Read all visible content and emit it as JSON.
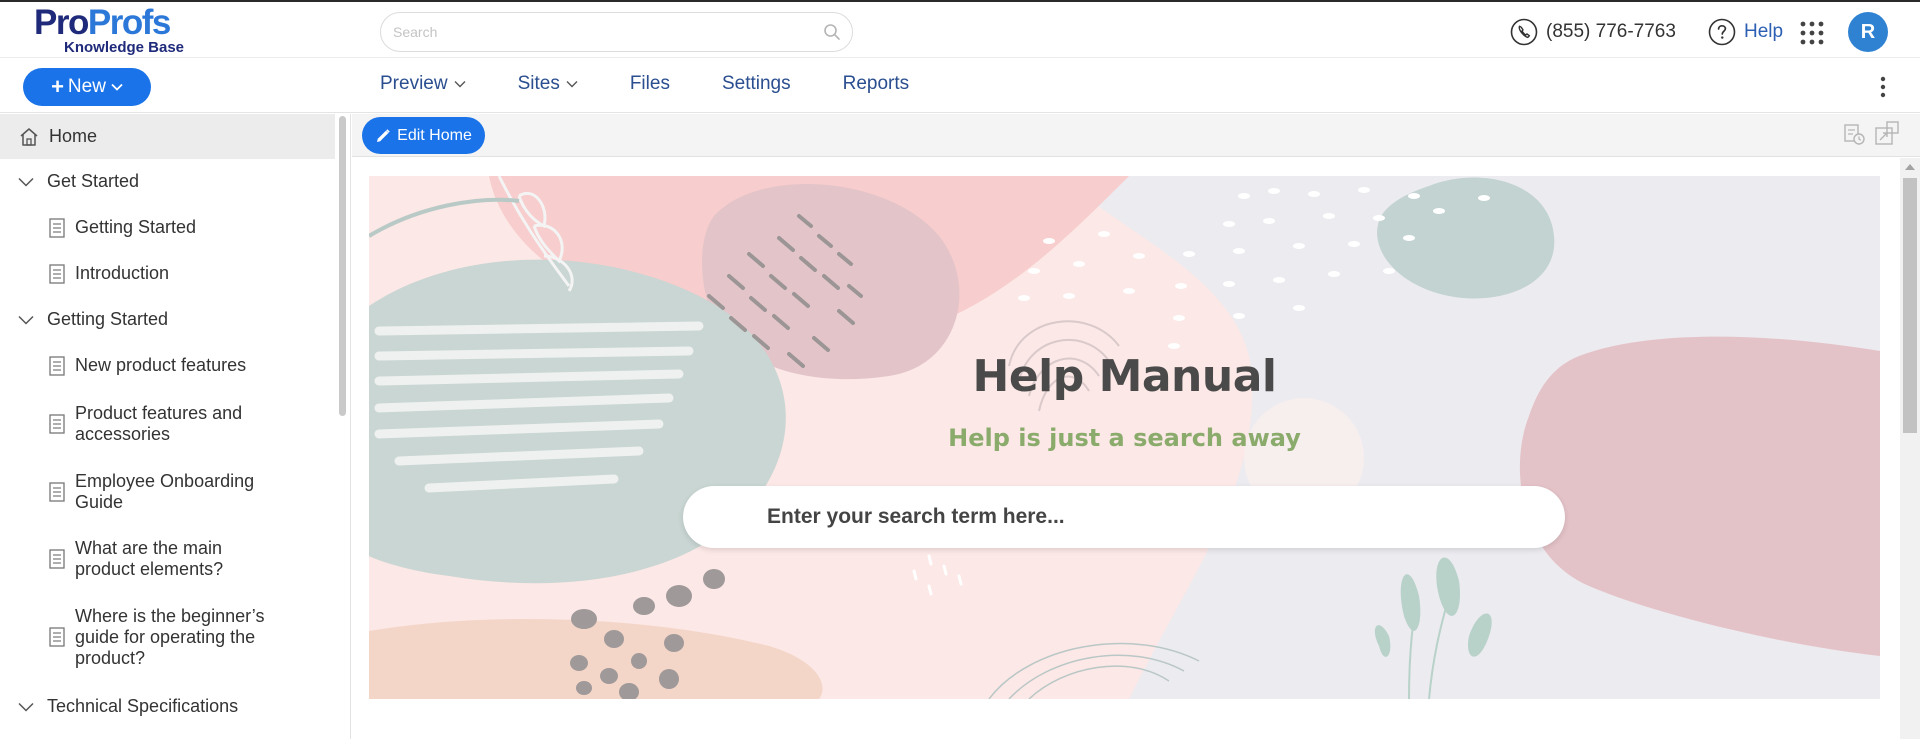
{
  "header": {
    "logo": {
      "brand_part1": "Pro",
      "brand_part2": "Profs",
      "product": "Knowledge Base"
    },
    "search_placeholder": "Search",
    "phone": "(855) 776-7763",
    "help_label": "Help",
    "avatar_initial": "R"
  },
  "toolbar": {
    "new_label": "New",
    "nav": [
      {
        "label": "Preview",
        "has_dropdown": true
      },
      {
        "label": "Sites",
        "has_dropdown": true
      },
      {
        "label": "Files",
        "has_dropdown": false
      },
      {
        "label": "Settings",
        "has_dropdown": false
      },
      {
        "label": "Reports",
        "has_dropdown": false
      }
    ]
  },
  "sidebar": {
    "home": "Home",
    "items": [
      {
        "type": "folder",
        "label": "Get Started"
      },
      {
        "type": "page",
        "lines": [
          "Getting Started"
        ]
      },
      {
        "type": "page",
        "lines": [
          "Introduction"
        ]
      },
      {
        "type": "folder",
        "label": "Getting Started"
      },
      {
        "type": "page",
        "lines": [
          "New product features"
        ]
      },
      {
        "type": "page",
        "lines": [
          "Product features and",
          "accessories"
        ]
      },
      {
        "type": "page",
        "lines": [
          "Employee Onboarding",
          "Guide"
        ]
      },
      {
        "type": "page",
        "lines": [
          "What are the main",
          "product elements?"
        ]
      },
      {
        "type": "page",
        "lines": [
          "Where is the beginner’s",
          "guide for operating the",
          "product?"
        ]
      },
      {
        "type": "folder",
        "label": "Technical Specifications"
      }
    ]
  },
  "main": {
    "edit_label": "Edit Home",
    "hero": {
      "title": "Help Manual",
      "subtitle": "Help is just a search away",
      "search_placeholder": "Enter your search term here..."
    }
  },
  "colors": {
    "primary_button": "#1a73e8",
    "nav_text": "#2a4e8f",
    "logo_dark": "#1f2a7a",
    "logo_light": "#2c78d8",
    "hero_subtitle": "#8aab6c",
    "avatar": "#2f82d2"
  },
  "icons": {
    "phone": "phone-icon",
    "help": "help-circle-icon",
    "apps": "apps-grid-icon",
    "search": "search-icon",
    "home": "home-icon",
    "folder_toggle": "chevron-down-icon",
    "page": "page-icon",
    "edit": "pencil-icon",
    "more": "kebab-icon"
  }
}
